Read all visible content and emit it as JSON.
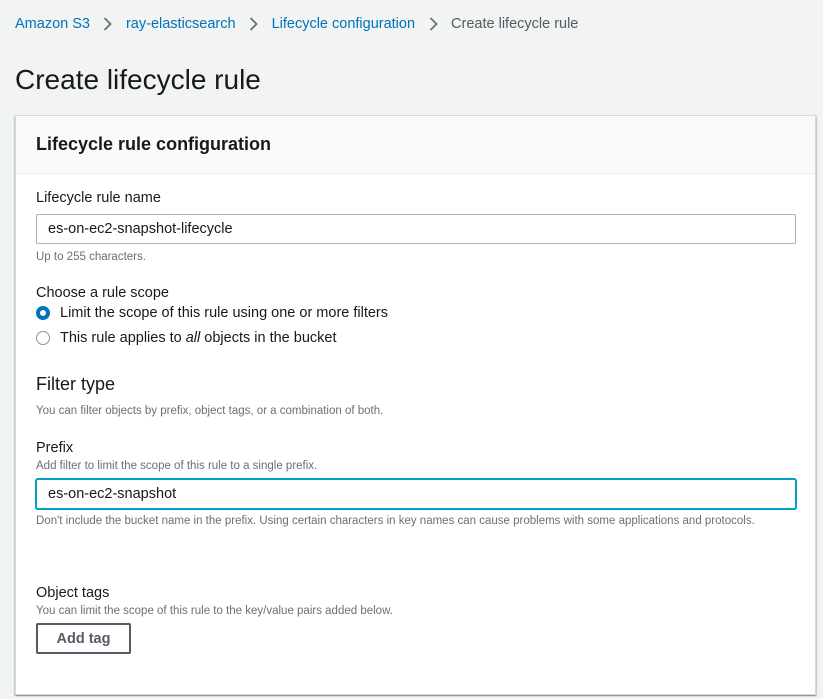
{
  "breadcrumb": {
    "items": [
      {
        "label": "Amazon S3"
      },
      {
        "label": "ray-elasticsearch"
      },
      {
        "label": "Lifecycle configuration"
      },
      {
        "label": "Create lifecycle rule"
      }
    ]
  },
  "page": {
    "title": "Create lifecycle rule"
  },
  "panel": {
    "title": "Lifecycle rule configuration"
  },
  "rule_name": {
    "label": "Lifecycle rule name",
    "value": "es-on-ec2-snapshot-lifecycle",
    "hint": "Up to 255 characters."
  },
  "scope": {
    "label": "Choose a rule scope",
    "option_filter": "Limit the scope of this rule using one or more filters",
    "option_all_prefix": "This rule applies to ",
    "option_all_em": "all",
    "option_all_suffix": " objects in the bucket",
    "selected": "filter"
  },
  "filter_type": {
    "title": "Filter type",
    "desc": "You can filter objects by prefix, object tags, or a combination of both."
  },
  "prefix": {
    "label": "Prefix",
    "desc": "Add filter to limit the scope of this rule to a single prefix.",
    "value": "es-on-ec2-snapshot",
    "hint": "Don't include the bucket name in the prefix. Using certain characters in key names can cause problems with some applications and protocols."
  },
  "object_tags": {
    "label": "Object tags",
    "desc": "You can limit the scope of this rule to the key/value pairs added below.",
    "add_button": "Add tag"
  },
  "colors": {
    "link": "#0073bb",
    "focus": "#00a1c9",
    "background": "#f2f3f3"
  }
}
